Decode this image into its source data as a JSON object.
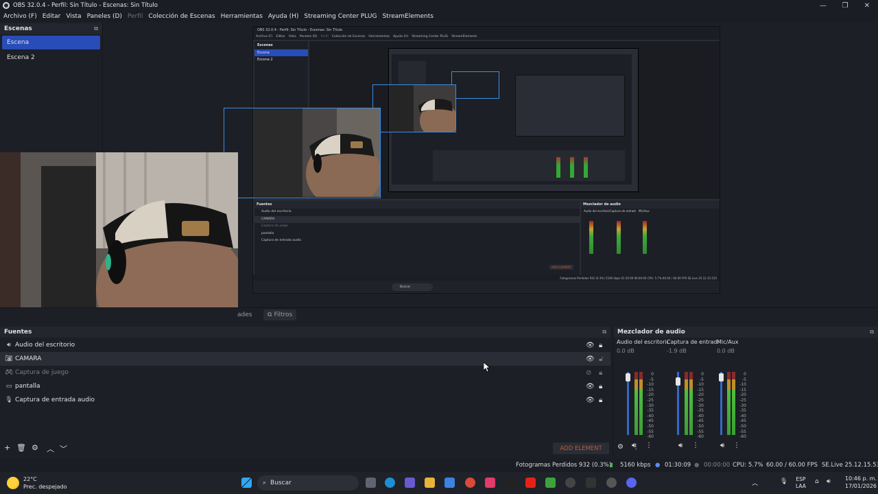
{
  "window": {
    "title": "OBS 32.0.4 - Perfil: Sin Título - Escenas: Sin Título",
    "controls": [
      "—",
      "❐",
      "✕"
    ]
  },
  "menu": {
    "items": [
      {
        "label": "Archivo (F)"
      },
      {
        "label": "Editar"
      },
      {
        "label": "Vista"
      },
      {
        "label": "Paneles (D)"
      },
      {
        "label": "Perfil"
      },
      {
        "label": "Colección de Escenas"
      },
      {
        "label": "Herramientas"
      },
      {
        "label": "Ayuda (H)"
      },
      {
        "label": "Streaming Center PLUG"
      },
      {
        "label": "StreamElements"
      }
    ]
  },
  "scenes": {
    "header": "Escenas",
    "items": [
      {
        "label": "Escena",
        "active": true
      },
      {
        "label": "Escena 2",
        "active": false
      }
    ]
  },
  "context": {
    "properties_tab_fragment": "ades",
    "filters_tab": "Filtros"
  },
  "sources": {
    "header": "Fuentes",
    "items": [
      {
        "name": "Audio del escritorio",
        "icon": "speaker-icon"
      },
      {
        "name": "CAMARA",
        "icon": "camera-icon"
      },
      {
        "name": "Captura de juego",
        "icon": "gamepad-icon"
      },
      {
        "name": "pantalla",
        "icon": "monitor-icon"
      },
      {
        "name": "Captura de entrada audio",
        "icon": "microphone-icon"
      }
    ],
    "add_element": "ADD ELEMENT"
  },
  "mixer": {
    "header": "Mezclador de audio",
    "channels": [
      {
        "name": "Audio del escritorio",
        "db": "0.0 dB"
      },
      {
        "name": "Captura de entrada",
        "db": "-1.9 dB"
      },
      {
        "name": "Mic/Aux",
        "db": "0.0 dB"
      }
    ],
    "scale": [
      "0",
      "-5",
      "-10",
      "-15",
      "-20",
      "-25",
      "-30",
      "-35",
      "-40",
      "-45",
      "-50",
      "-55",
      "-60"
    ]
  },
  "status": {
    "dropped_frames": "Fotogramas Perdidos 932 (0.3%)",
    "bitrate": "5160 kbps",
    "stream_time": "01:30:09",
    "rec_time": "00:00:00",
    "cpu": "CPU: 5.7%",
    "fps": "60.00 / 60.00 FPS",
    "version": "SE.Live 25.12.15.535"
  },
  "taskbar": {
    "temp": "22°C",
    "weather": "Prec. despejado",
    "search": "Buscar",
    "lang_top": "ESP",
    "lang_bottom": "LAA",
    "time": "10:46 p. m.",
    "date": "17/01/2026"
  },
  "mini": {
    "title": "OBS 32.0.4 - Perfil: Sin Título - Escenas: Sin Título",
    "menu": [
      "Archivo (F)",
      "Editar",
      "Vista",
      "Paneles (D)",
      "Perfil",
      "Colección de Escenas",
      "Herramientas",
      "Ayuda (H)",
      "Streaming Center PLUG",
      "StreamElements"
    ],
    "scenes_header": "Escenas",
    "scene1": "Escena",
    "scene2": "Escena 2",
    "sources_header": "Fuentes",
    "sources": [
      "Audio del escritorio",
      "CAMARA",
      "Captura de juego",
      "pantalla",
      "Captura de entrada audio"
    ],
    "mixer_header": "Mezclador de audio",
    "mixer_channels": [
      "Audio del escritorio",
      "Captura de entrada",
      "Mic/Aux"
    ],
    "add_element": "ADD ELEMENT",
    "status": "Fotogramas Perdidos 932 (0.3%)   5160 kbps   01:30:09   00:00:00   CPU: 5.7%   60.00 / 60.00 FPS   SE.Live 25.12.15.535",
    "search": "Buscar"
  }
}
